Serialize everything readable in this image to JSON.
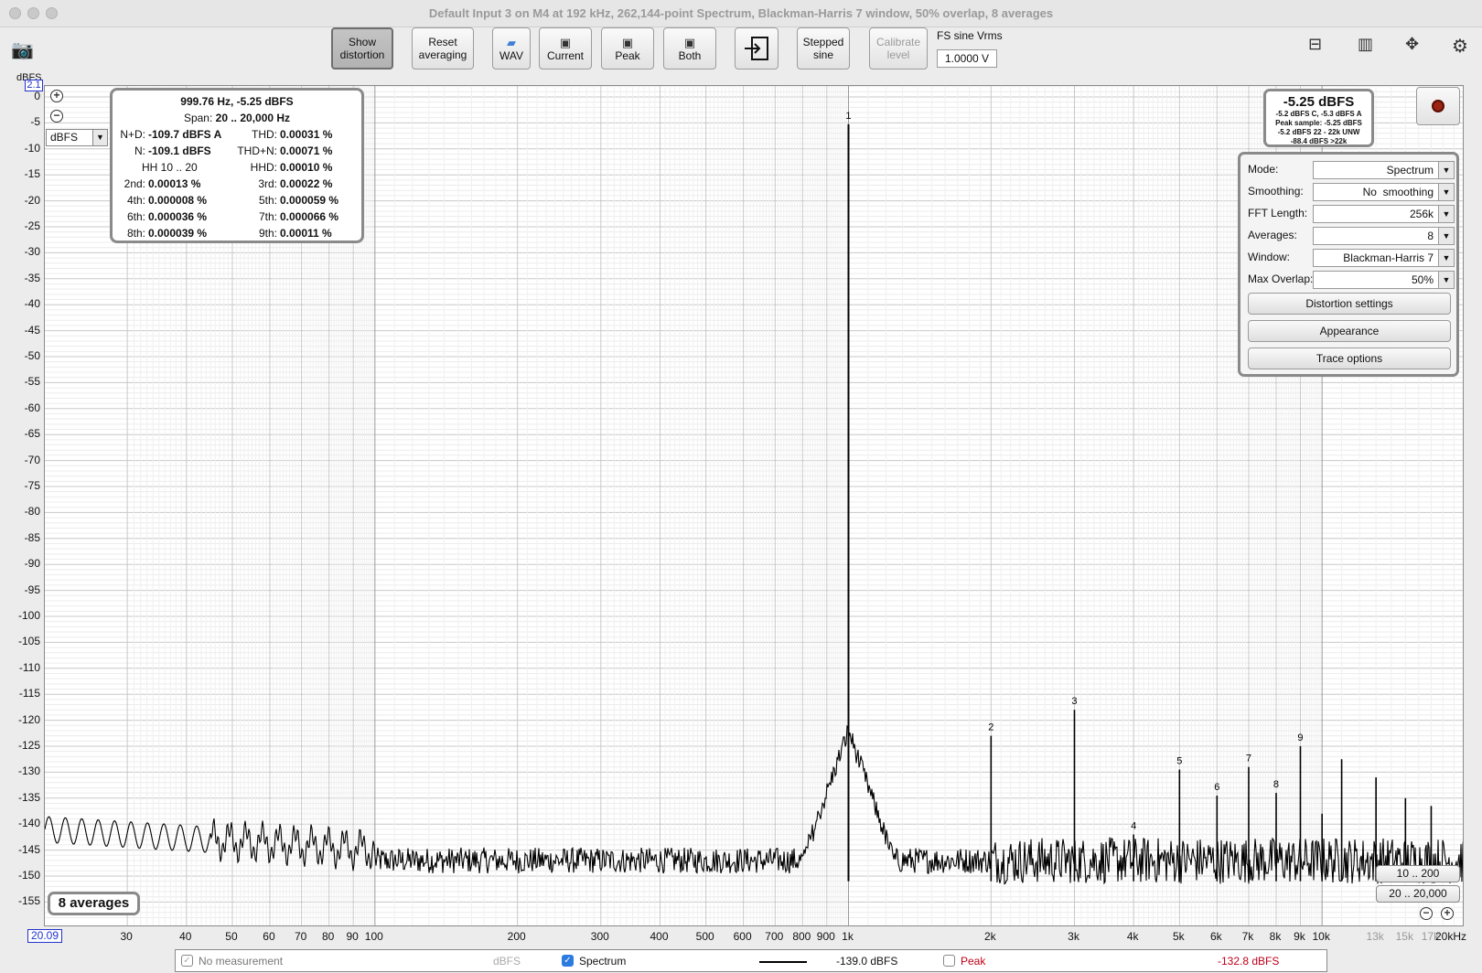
{
  "window": {
    "title": "Default Input 3 on M4 at 192 kHz, 262,144-point Spectrum, Blackman-Harris 7 window, 50% overlap, 8 averages"
  },
  "toolbar": {
    "show_distortion": [
      "Show",
      "distortion"
    ],
    "reset_averaging": [
      "Reset",
      "averaging"
    ],
    "wav": "WAV",
    "current": "Current",
    "peak": "Peak",
    "both": "Both",
    "stepped_sine": [
      "Stepped",
      "sine"
    ],
    "calibrate_level": [
      "Calibrate",
      "level"
    ],
    "fs_label": "FS sine Vrms",
    "fs_value": "1.0000 V"
  },
  "plot": {
    "y_unit": "dBFS",
    "y_top_box": "2.1",
    "x_left_box": "20.09",
    "unit_select": "dBFS",
    "y_ticks": [
      "0",
      "-5",
      "-10",
      "-15",
      "-20",
      "-25",
      "-30",
      "-35",
      "-40",
      "-45",
      "-50",
      "-55",
      "-60",
      "-65",
      "-70",
      "-75",
      "-80",
      "-85",
      "-90",
      "-95",
      "-100",
      "-105",
      "-110",
      "-115",
      "-120",
      "-125",
      "-130",
      "-135",
      "-140",
      "-145",
      "-150",
      "-155"
    ],
    "x_ticks": [
      {
        "f": 30,
        "label": "30"
      },
      {
        "f": 40,
        "label": "40"
      },
      {
        "f": 50,
        "label": "50"
      },
      {
        "f": 60,
        "label": "60"
      },
      {
        "f": 70,
        "label": "70"
      },
      {
        "f": 80,
        "label": "80"
      },
      {
        "f": 90,
        "label": "90"
      },
      {
        "f": 100,
        "label": "100"
      },
      {
        "f": 200,
        "label": "200"
      },
      {
        "f": 300,
        "label": "300"
      },
      {
        "f": 400,
        "label": "400"
      },
      {
        "f": 500,
        "label": "500"
      },
      {
        "f": 600,
        "label": "600"
      },
      {
        "f": 700,
        "label": "700"
      },
      {
        "f": 800,
        "label": "800"
      },
      {
        "f": 900,
        "label": "900"
      },
      {
        "f": 1000,
        "label": "1k"
      },
      {
        "f": 2000,
        "label": "2k"
      },
      {
        "f": 3000,
        "label": "3k"
      },
      {
        "f": 4000,
        "label": "4k"
      },
      {
        "f": 5000,
        "label": "5k"
      },
      {
        "f": 6000,
        "label": "6k"
      },
      {
        "f": 7000,
        "label": "7k"
      },
      {
        "f": 8000,
        "label": "8k"
      },
      {
        "f": 9000,
        "label": "9k"
      },
      {
        "f": 10000,
        "label": "10k"
      },
      {
        "f": 13000,
        "label": "13k",
        "grey": true
      },
      {
        "f": 15000,
        "label": "15k",
        "grey": true
      },
      {
        "f": 17000,
        "label": "17k",
        "grey": true
      },
      {
        "f": 20000,
        "label": "20kHz"
      }
    ],
    "averages_badge": "8 averages",
    "range_a": "10 .. 200",
    "range_b": "20 .. 20,000"
  },
  "chart_data": {
    "type": "line",
    "xlabel": "",
    "ylabel": "dBFS",
    "x_scale": "log",
    "xlim": [
      20.09,
      20000
    ],
    "ylim": [
      -158,
      2.1
    ],
    "grid": true,
    "noise_floor_dbfs": -147,
    "harmonics": [
      {
        "label": "1",
        "freq": 1000,
        "dbfs": -5.25
      },
      {
        "label": "2",
        "freq": 2000,
        "dbfs": -123
      },
      {
        "label": "3",
        "freq": 3000,
        "dbfs": -118
      },
      {
        "label": "4",
        "freq": 4000,
        "dbfs": -142
      },
      {
        "label": "5",
        "freq": 5000,
        "dbfs": -129.5
      },
      {
        "label": "6",
        "freq": 6000,
        "dbfs": -134.5
      },
      {
        "label": "7",
        "freq": 7000,
        "dbfs": -129
      },
      {
        "label": "8",
        "freq": 8000,
        "dbfs": -134
      },
      {
        "label": "9",
        "freq": 9000,
        "dbfs": -125
      }
    ],
    "other_spurs": [
      {
        "freq": 10000,
        "dbfs": -138
      },
      {
        "freq": 11000,
        "dbfs": -127.5
      },
      {
        "freq": 13000,
        "dbfs": -131
      },
      {
        "freq": 15000,
        "dbfs": -135
      },
      {
        "freq": 17000,
        "dbfs": -136.5
      }
    ]
  },
  "distortion": {
    "head1": "999.76 Hz, -5.25 dBFS",
    "span_label": "Span:",
    "span_value": "20 .. 20,000 Hz",
    "nd_label": "N+D:",
    "nd_value": "-109.7 dBFS A",
    "thd_label": "THD:",
    "thd_value": "0.00031 %",
    "n_label": "N:",
    "n_value": "-109.1 dBFS",
    "thdn_label": "THD+N:",
    "thdn_value": "0.00071 %",
    "hh_label": "HH 10 .. 20",
    "hhd_label": "HHD:",
    "hhd_value": "0.00010 %",
    "h2_label": "2nd:",
    "h2_value": "0.00013 %",
    "h3_label": "3rd:",
    "h3_value": "0.00022 %",
    "h4_label": "4th:",
    "h4_value": "0.000008 %",
    "h5_label": "5th:",
    "h5_value": "0.000059 %",
    "h6_label": "6th:",
    "h6_value": "0.000036 %",
    "h7_label": "7th:",
    "h7_value": "0.000066 %",
    "h8_label": "8th:",
    "h8_value": "0.000039 %",
    "h9_label": "9th:",
    "h9_value": "0.00011 %"
  },
  "level": {
    "main": "-5.25 dBFS",
    "l1": "-5.2 dBFS C, -5.3 dBFS A",
    "l2": "Peak sample: -5.25 dBFS",
    "l3": "-5.2 dBFS 22 - 22k UNW",
    "l4": "-88.4 dBFS >22k"
  },
  "settings": {
    "mode_label": "Mode:",
    "mode_value": "Spectrum",
    "smoothing_label": "Smoothing:",
    "smoothing_value": "No  smoothing",
    "fft_label": "FFT Length:",
    "fft_value": "256k",
    "avg_label": "Averages:",
    "avg_value": "8",
    "window_label": "Window:",
    "window_value": "Blackman-Harris 7",
    "overlap_label": "Max Overlap:",
    "overlap_value": "50%",
    "distortion_settings": "Distortion settings",
    "appearance": "Appearance",
    "trace_options": "Trace options"
  },
  "legend": {
    "no_measurement": "No measurement",
    "unit": "dBFS",
    "spectrum": "Spectrum",
    "spectrum_value": "-139.0 dBFS",
    "peak": "Peak",
    "peak_value": "-132.8 dBFS",
    "peak_color": "#c0001a"
  }
}
